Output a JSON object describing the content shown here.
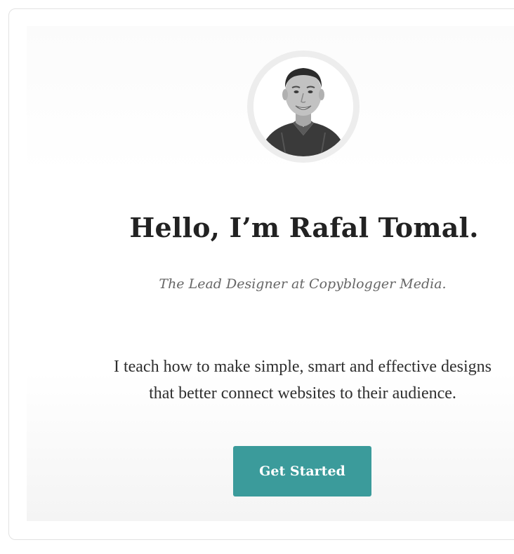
{
  "hero": {
    "avatar_icon": "portrait-photo",
    "headline": "Hello, I’m Rafal Tomal.",
    "subtitle": "The Lead Designer at Copyblogger Media.",
    "body_line1": "I teach how to make simple, smart and effective designs",
    "body_line2": "that better connect websites to their audience.",
    "cta_label": "Get Started",
    "accent_color": "#3b9b9b"
  }
}
